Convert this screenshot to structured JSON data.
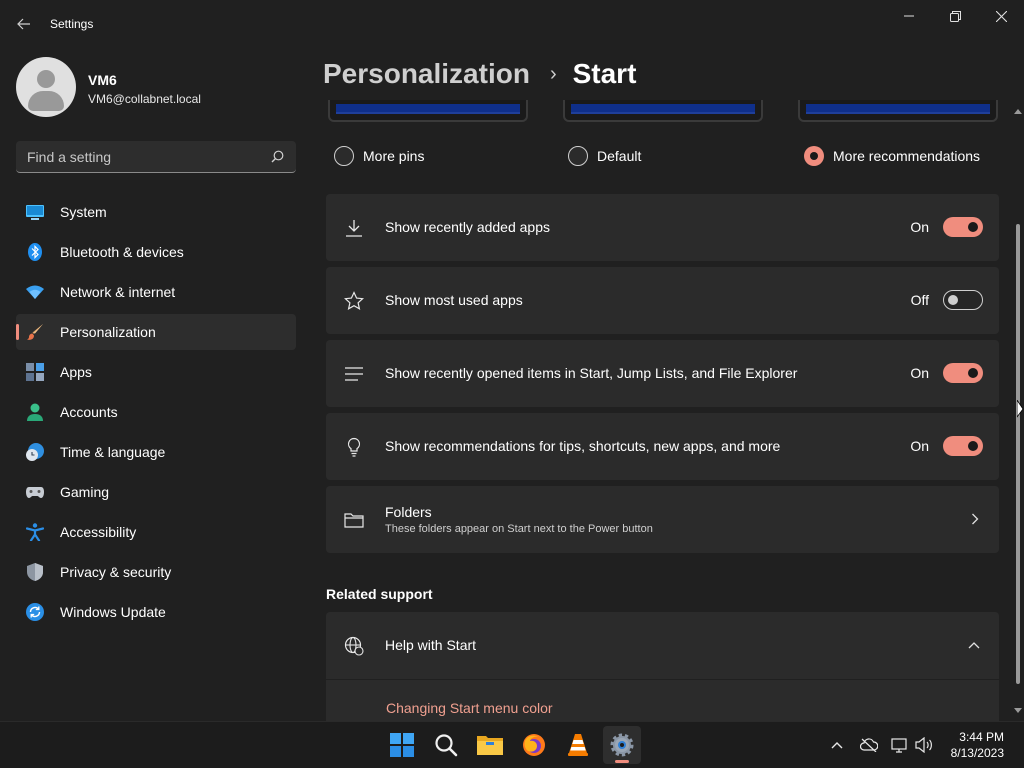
{
  "window": {
    "app_title": "Settings",
    "controls": [
      "minimize-icon",
      "restore-icon",
      "close-icon"
    ]
  },
  "profile": {
    "name": "VM6",
    "email": "VM6@collabnet.local"
  },
  "search": {
    "placeholder": "Find a setting"
  },
  "nav": {
    "items": [
      {
        "label": "System",
        "icon": "monitor-icon"
      },
      {
        "label": "Bluetooth & devices",
        "icon": "bluetooth-icon"
      },
      {
        "label": "Network & internet",
        "icon": "wifi-icon"
      },
      {
        "label": "Personalization",
        "icon": "brush-icon",
        "active": true
      },
      {
        "label": "Apps",
        "icon": "apps-icon"
      },
      {
        "label": "Accounts",
        "icon": "person-icon"
      },
      {
        "label": "Time & language",
        "icon": "globe-clock-icon"
      },
      {
        "label": "Gaming",
        "icon": "gamepad-icon"
      },
      {
        "label": "Accessibility",
        "icon": "accessibility-icon"
      },
      {
        "label": "Privacy & security",
        "icon": "shield-icon"
      },
      {
        "label": "Windows Update",
        "icon": "update-icon"
      }
    ]
  },
  "breadcrumb": {
    "parent": "Personalization",
    "separator": "›",
    "current": "Start"
  },
  "layout_options": [
    {
      "label": "More pins",
      "checked": false
    },
    {
      "label": "Default",
      "checked": false
    },
    {
      "label": "More recommendations",
      "checked": true
    }
  ],
  "settings": [
    {
      "label": "Show recently added apps",
      "state": "On",
      "on": true,
      "icon": "download-icon"
    },
    {
      "label": "Show most used apps",
      "state": "Off",
      "on": false,
      "icon": "star-icon"
    },
    {
      "label": "Show recently opened items in Start, Jump Lists, and File Explorer",
      "state": "On",
      "on": true,
      "icon": "list-icon"
    },
    {
      "label": "Show recommendations for tips, shortcuts, new apps, and more",
      "state": "On",
      "on": true,
      "icon": "lightbulb-icon"
    }
  ],
  "folders": {
    "title": "Folders",
    "description": "These folders appear on Start next to the Power button"
  },
  "related": {
    "title": "Related support",
    "help_title": "Help with Start",
    "link": "Changing Start menu color"
  },
  "taskbar": {
    "apps": [
      "windows-start-icon",
      "search-icon",
      "file-explorer-icon",
      "firefox-icon",
      "vlc-icon",
      "settings-icon"
    ],
    "time": "3:44 PM",
    "date": "8/13/2023"
  },
  "colors": {
    "accent": "#f08d7e",
    "background": "#202020",
    "card": "#2b2b2b"
  }
}
